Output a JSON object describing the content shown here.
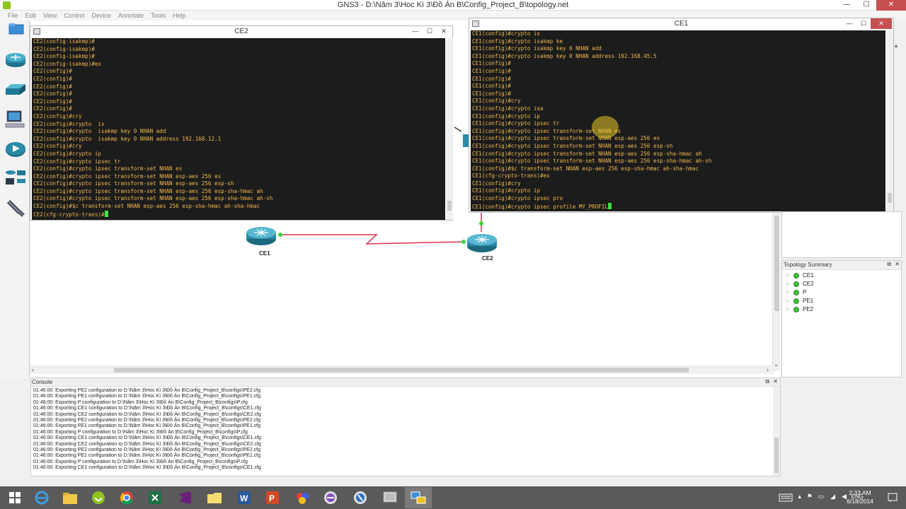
{
  "app": {
    "title": "GNS3 - D:\\Năm 3\\Hoc Kì 3\\Đồ Án B\\Config_Project_B\\topology.net",
    "menu": [
      "File",
      "Edit",
      "View",
      "Control",
      "Device",
      "Annotate",
      "Tools",
      "Help"
    ]
  },
  "window_controls": {
    "minimize": "—",
    "maximize": "☐",
    "close": "✕"
  },
  "devices": [
    {
      "name": "router-icon"
    },
    {
      "name": "switch-icon"
    },
    {
      "name": "end-device-icon"
    },
    {
      "name": "security-device-icon"
    },
    {
      "name": "all-devices-icon"
    },
    {
      "name": "cable-icon"
    }
  ],
  "topology_nodes": [
    {
      "label": "CE1"
    },
    {
      "label": "CE2"
    }
  ],
  "terminal_ce2": {
    "title": "CE2",
    "lines": [
      "CE2(config-isakmp)#",
      "CE2(config-isakmp)#",
      "CE2(config-isakmp)#",
      "CE2(config-isakmp)#ex",
      "CE2(config)#",
      "CE2(config)#",
      "CE2(config)#",
      "CE2(config)#",
      "CE2(config)#",
      "CE2(config)#",
      "CE2(config)#cry",
      "CE2(config)#crypto  is",
      "CE2(config)#crypto  isakmp key 0 NHAN add",
      "CE2(config)#crypto  isakmp key 0 NHAN address 192.168.12.1",
      "CE2(config)#cry",
      "CE2(config)#crypto ip",
      "CE2(config)#crypto ipsec tr",
      "CE2(config)#crypto ipsec transform-set NHAN es",
      "CE2(config)#crypto ipsec transform-set NHAN esp-aes 256 es",
      "CE2(config)#crypto ipsec transform-set NHAN esp-aes 256 esp-sh",
      "CE2(config)#crypto ipsec transform-set NHAN esp-aes 256 esp-sha-hmac ah",
      "CE2(config)#crypto ipsec transform-set NHAN esp-aes 256 esp-sha-hmac ah-sh",
      "CE2(config)#$c transform-set NHAN esp-aes 256 esp-sha-hmac ah-sha-hmac"
    ],
    "prompt": "CE2(cfg-crypto-trans)#"
  },
  "terminal_ce1": {
    "title": "CE1",
    "lines": [
      "CE1(config)#crypto is",
      "CE1(config)#crypto isakmp ke",
      "CE1(config)#crypto isakmp key 0 NHAN add",
      "CE1(config)#crypto isakmp key 0 NHAN address 192.168.45.5",
      "CE1(config)#",
      "CE1(config)#",
      "CE1(config)#",
      "CE1(config)#",
      "CE1(config)#",
      "CE1(config)#cry",
      "CE1(config)#crypto isa",
      "CE1(config)#crypto ip",
      "CE1(config)#crypto ipsec tr",
      "CE1(config)#crypto ipsec transform-set NHAN es",
      "CE1(config)#crypto ipsec transform-set NHAN esp-aes 256 es",
      "CE1(config)#crypto ipsec transform-set NHAN esp-aes 256 esp-sh",
      "CE1(config)#crypto ipsec transform-set NHAN esp-aes 256 esp-sha-hmac ah",
      "CE1(config)#crypto ipsec transform-set NHAN esp-aes 256 esp-sha-hmac ah-sh",
      "CE1(config)#$c transform-set NHAN esp-aes 256 esp-sha-hmac ah-sha-hmac",
      "CE1(cfg-crypto-trans)#ex",
      "CE1(config)#cry",
      "CE1(config)#crypto ip",
      "CE1(config)#crypto ipsec pro"
    ],
    "prompt": "CE1(config)#crypto ipsec profile MY_PROFIL"
  },
  "topology_summary": {
    "title": "Topology Summary",
    "nodes": [
      "CE1",
      "CE2",
      "P",
      "PE1",
      "PE2"
    ]
  },
  "panel_controls": {
    "float": "⧉",
    "close": "✕"
  },
  "console": {
    "title": "Console",
    "lines": [
      "01:46:00: Exporting PE2 configuration to D:\\Năm 3\\Hoc Kì 3\\Đồ Án B\\Config_Project_B\\configs\\PE2.cfg",
      "01:46:00: Exporting PE1 configuration to D:\\Năm 3\\Hoc Kì 3\\Đồ Án B\\Config_Project_B\\configs\\PE1.cfg",
      "01:46:00: Exporting P configuration to D:\\Năm 3\\Hoc Kì 3\\Đồ Án B\\Config_Project_B\\configs\\P.cfg",
      "01:46:00: Exporting CE1 configuration to D:\\Năm 3\\Hoc Kì 3\\Đồ Án B\\Config_Project_B\\configs\\CE1.cfg",
      "01:46:00: Exporting CE2 configuration to D:\\Năm 3\\Hoc Kì 3\\Đồ Án B\\Config_Project_B\\configs\\CE2.cfg",
      "01:46:00: Exporting PE2 configuration to D:\\Năm 3\\Hoc Kì 3\\Đồ Án B\\Config_Project_B\\configs\\PE2.cfg",
      "01:46:00: Exporting PE1 configuration to D:\\Năm 3\\Hoc Kì 3\\Đồ Án B\\Config_Project_B\\configs\\PE1.cfg",
      "01:46:00: Exporting P configuration to D:\\Năm 3\\Hoc Kì 3\\Đồ Án B\\Config_Project_B\\configs\\P.cfg",
      "01:46:00: Exporting CE1 configuration to D:\\Năm 3\\Hoc Kì 3\\Đồ Án B\\Config_Project_B\\configs\\CE1.cfg",
      "01:46:00: Exporting CE2 configuration to D:\\Năm 3\\Hoc Kì 3\\Đồ Án B\\Config_Project_B\\configs\\CE2.cfg",
      "01:46:00: Exporting PE2 configuration to D:\\Năm 3\\Hoc Kì 3\\Đồ Án B\\Config_Project_B\\configs\\PE2.cfg",
      "01:46:00: Exporting PE1 configuration to D:\\Năm 3\\Hoc Kì 3\\Đồ Án B\\Config_Project_B\\configs\\PE1.cfg",
      "01:46:00: Exporting P configuration to D:\\Năm 3\\Hoc Kì 3\\Đồ Án B\\Config_Project_B\\configs\\P.cfg",
      "01:46:00: Exporting CE1 configuration to D:\\Năm 3\\Hoc Kì 3\\Đồ Án B\\Config_Project_B\\configs\\CE1.cfg"
    ]
  },
  "taskbar": {
    "apps": [
      {
        "name": "start-button"
      },
      {
        "name": "internet-explorer-icon"
      },
      {
        "name": "file-explorer-icon"
      },
      {
        "name": "gns3-icon"
      },
      {
        "name": "chrome-icon"
      },
      {
        "name": "excel-icon"
      },
      {
        "name": "visual-studio-icon"
      },
      {
        "name": "folder-icon"
      },
      {
        "name": "word-icon"
      },
      {
        "name": "powerpoint-icon"
      },
      {
        "name": "app-icon"
      },
      {
        "name": "wireshark-icon"
      },
      {
        "name": "wireshark-icon-2"
      },
      {
        "name": "console-icon"
      },
      {
        "name": "network-app-icon"
      }
    ],
    "language": "ENG",
    "time": "2:33 AM",
    "date": "6/18/2014"
  },
  "colors": {
    "terminal_bg": "#1c1c1c",
    "terminal_text": "#f0b850",
    "cursor": "#40e040",
    "link": "#d9334a",
    "link_endpoint": "#3cd63c",
    "taskbar": "#5a5a5a",
    "close_button": "#c75050"
  }
}
